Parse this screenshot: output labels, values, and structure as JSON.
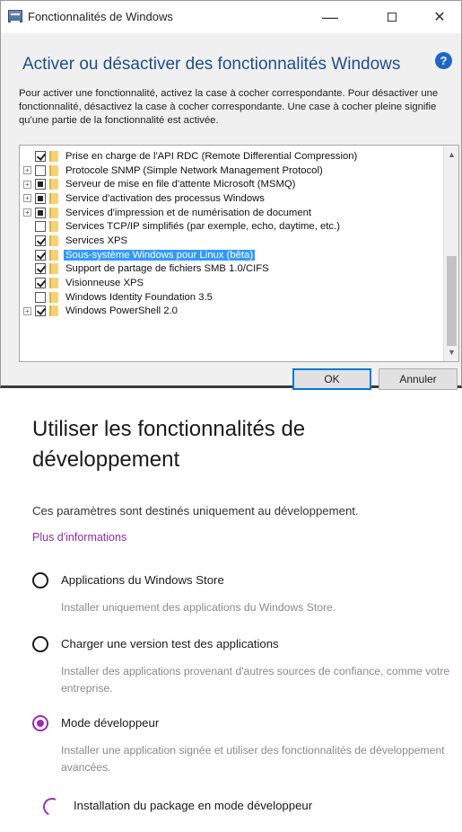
{
  "dialog": {
    "title": "Fonctionnalités de Windows",
    "controls": {
      "minimize": "—",
      "close": "✕"
    },
    "heading": "Activer ou désactiver des fonctionnalités Windows",
    "help": "?",
    "description": "Pour activer une fonctionnalité, activez la case à cocher correspondante. Pour désactiver une fonctionnalité, désactivez la case à cocher correspondante. Une case à cocher pleine signifie qu'une partie de la fonctionnalité est activée.",
    "features": [
      {
        "label": "Prise en charge de l'API RDC (Remote Differential Compression)",
        "state": "checked",
        "expandable": false,
        "selected": false
      },
      {
        "label": "Protocole SNMP (Simple Network Management Protocol)",
        "state": "unchecked",
        "expandable": true,
        "selected": false
      },
      {
        "label": "Serveur de mise en file d'attente Microsoft (MSMQ)",
        "state": "partial",
        "expandable": true,
        "selected": false
      },
      {
        "label": "Service d'activation des processus Windows",
        "state": "partial",
        "expandable": true,
        "selected": false
      },
      {
        "label": "Services d'impression et de numérisation de document",
        "state": "partial",
        "expandable": true,
        "selected": false
      },
      {
        "label": "Services TCP/IP simplifiés (par exemple, echo, daytime, etc.)",
        "state": "unchecked",
        "expandable": false,
        "selected": false
      },
      {
        "label": "Services XPS",
        "state": "checked",
        "expandable": false,
        "selected": false
      },
      {
        "label": "Sous-système Windows pour Linux (bêta)",
        "state": "checked",
        "expandable": false,
        "selected": true
      },
      {
        "label": "Support de partage de fichiers SMB 1.0/CIFS",
        "state": "checked",
        "expandable": false,
        "selected": false
      },
      {
        "label": "Visionneuse XPS",
        "state": "checked",
        "expandable": false,
        "selected": false
      },
      {
        "label": "Windows Identity Foundation 3.5",
        "state": "unchecked",
        "expandable": false,
        "selected": false
      },
      {
        "label": "Windows PowerShell 2.0",
        "state": "checked",
        "expandable": true,
        "selected": false
      }
    ],
    "ok_label": "OK",
    "cancel_label": "Annuler"
  },
  "developer": {
    "title": "Utiliser les fonctionnalités de développement",
    "description": "Ces paramètres sont destinés uniquement au développement.",
    "more_info": "Plus d'informations",
    "options": [
      {
        "label": "Applications du Windows Store",
        "description": "Installer uniquement des applications du Windows Store.",
        "selected": false
      },
      {
        "label": "Charger une version test des applications",
        "description": "Installer des applications provenant d'autres sources de confiance, comme votre entreprise.",
        "selected": false
      },
      {
        "label": "Mode développeur",
        "description": "Installer une application signée et utiliser des fonctionnalités de développement avancées.",
        "selected": true
      }
    ],
    "install_status": "Installation du package en mode développeur"
  },
  "colors": {
    "accent": "#9a2eb0",
    "heading_blue": "#1f4e8c",
    "selection": "#3399ff"
  }
}
